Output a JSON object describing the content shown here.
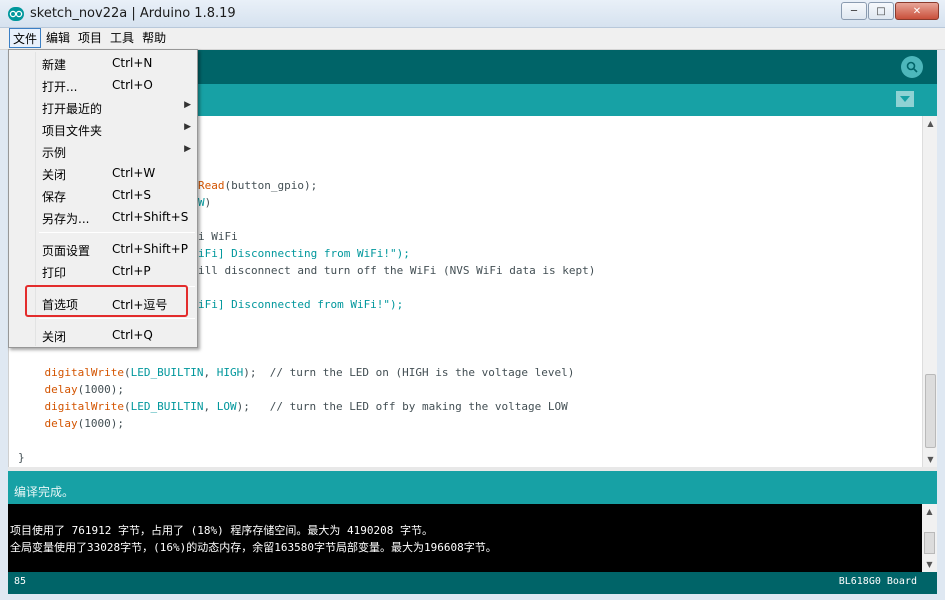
{
  "window": {
    "title": "sketch_nov22a | Arduino 1.8.19",
    "controls": {
      "minimize": "─",
      "maximize": "□",
      "close": "✕"
    }
  },
  "menubar": {
    "items": [
      "文件",
      "编辑",
      "项目",
      "工具",
      "帮助"
    ]
  },
  "file_menu": {
    "items": [
      {
        "label": "新建",
        "shortcut": "Ctrl+N"
      },
      {
        "label": "打开...",
        "shortcut": "Ctrl+O"
      },
      {
        "label": "打开最近的",
        "shortcut": "",
        "submenu": true
      },
      {
        "label": "项目文件夹",
        "shortcut": "",
        "submenu": true
      },
      {
        "label": "示例",
        "shortcut": "",
        "submenu": true
      },
      {
        "label": "关闭",
        "shortcut": "Ctrl+W"
      },
      {
        "label": "保存",
        "shortcut": "Ctrl+S"
      },
      {
        "label": "另存为...",
        "shortcut": "Ctrl+Shift+S"
      },
      {
        "label": "页面设置",
        "shortcut": "Ctrl+Shift+P"
      },
      {
        "label": "打印",
        "shortcut": "Ctrl+P"
      },
      {
        "label": "首选项",
        "shortcut": "Ctrl+逗号",
        "highlighted": true
      },
      {
        "label": "关闭",
        "shortcut": "Ctrl+Q"
      }
    ]
  },
  "editor": {
    "lines": [
      "Read(button_gpio);",
      "W)",
      "i WiFi",
      "iFi] Disconnecting from WiFi!\");",
      "ill disconnect and turn off the WiFi (NVS WiFi data is kept)",
      "iFi] Disconnected from WiFi!\");",
      "    digitalWrite(LED_BUILTIN, HIGH);  // turn the LED on (HIGH is the voltage level)",
      "    delay(1000);",
      "    digitalWrite(LED_BUILTIN, LOW);   // turn the LED off by making the voltage LOW",
      "    delay(1000);",
      "}"
    ]
  },
  "status": {
    "message": "编译完成。"
  },
  "console": {
    "lines": [
      "项目使用了 761912 字节，占用了 (18%) 程序存储空间。最大为 4190208 字节。",
      "全局变量使用了33028字节，(16%)的动态内存，余留163580字节局部变量。最大为196608字节。"
    ]
  },
  "footer": {
    "line_number": "85",
    "board": "BL618G0 Board"
  },
  "colors": {
    "toolbar": "#006468",
    "tabbar": "#17a1a5",
    "highlight": "#e32c2c"
  }
}
